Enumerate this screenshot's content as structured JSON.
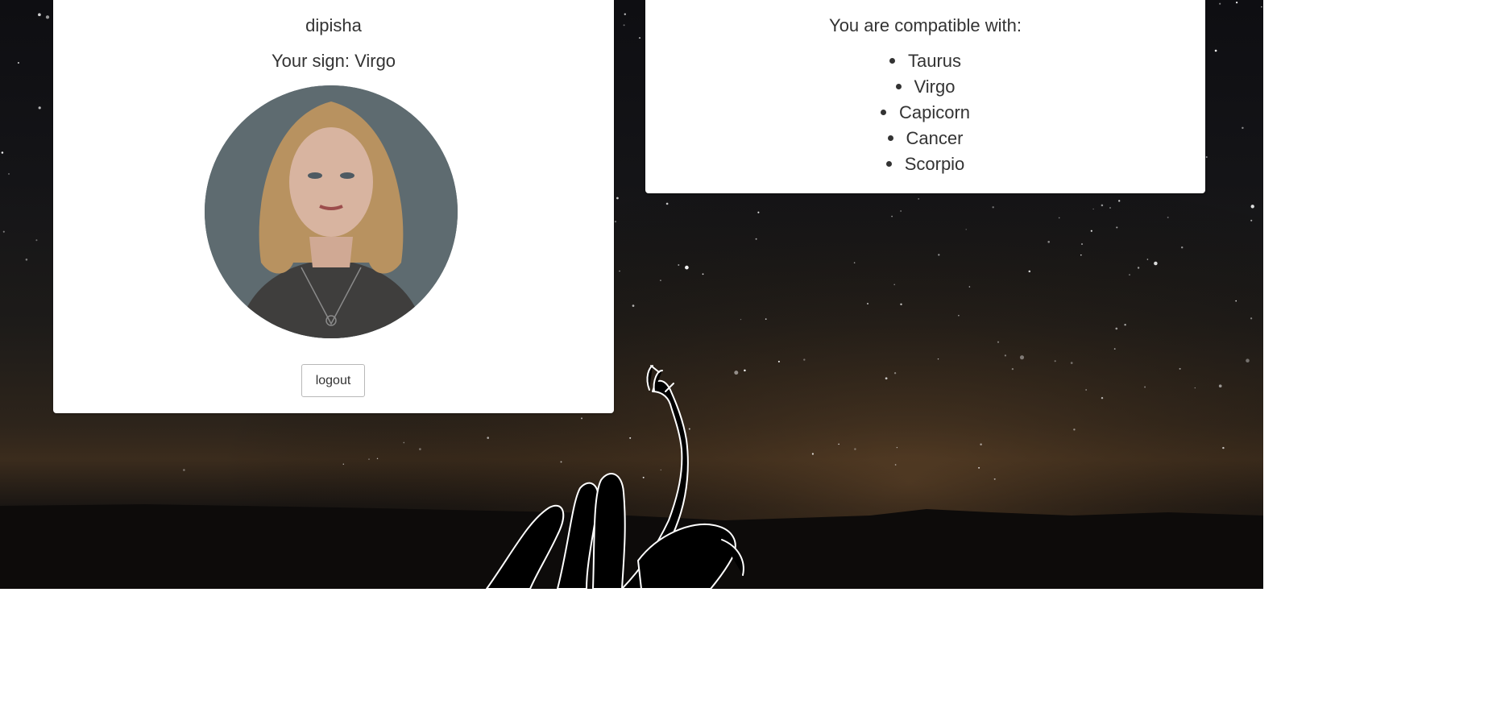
{
  "profile": {
    "username": "dipisha",
    "sign_line": "Your sign: Virgo",
    "logout_label": "logout"
  },
  "compatibility": {
    "title": "You are compatible with:",
    "signs": [
      "Taurus",
      "Virgo",
      "Capicorn",
      "Cancer",
      "Scorpio"
    ]
  },
  "colors": {
    "card_background": "#ffffff",
    "text": "#333333",
    "night_sky": "#141417",
    "horizon_glow": "#3b2c1d"
  },
  "icons": {
    "background": "starry-night-sky",
    "decoration": "hand-sketch-pointing-up"
  }
}
